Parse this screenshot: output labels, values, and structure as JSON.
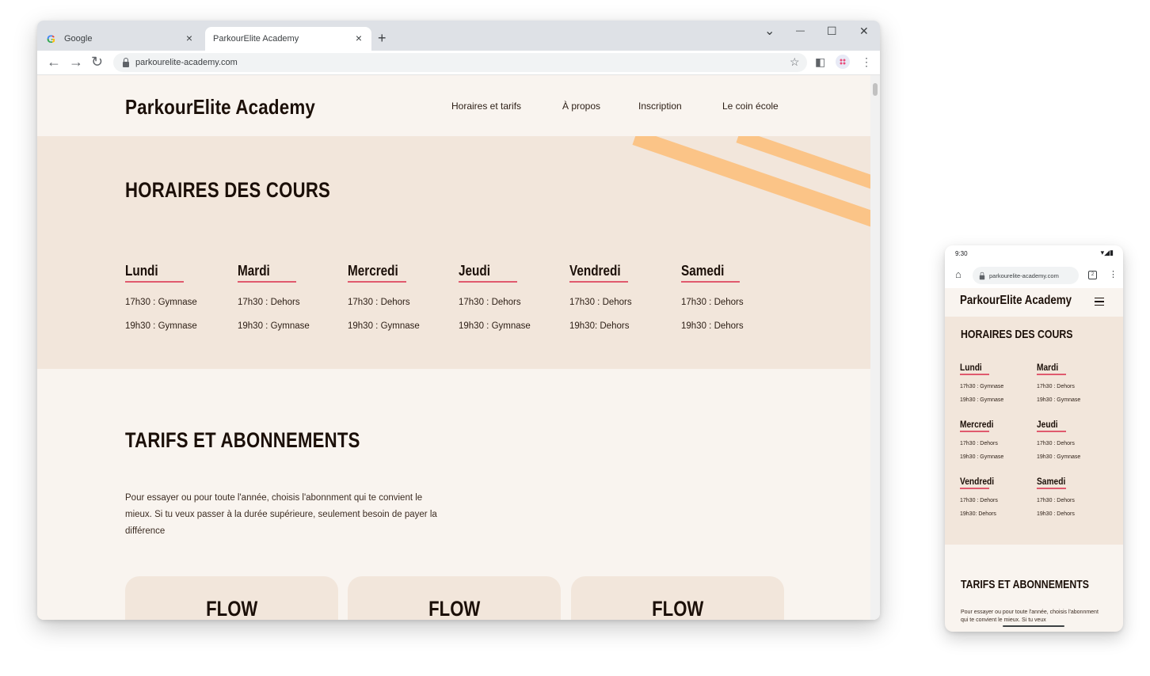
{
  "browser": {
    "tabs": [
      {
        "label": "Google",
        "icon": "google-icon"
      },
      {
        "label": "ParkourElite Academy",
        "active": true
      }
    ],
    "url": "parkourelite-academy.com",
    "new_tab_symbol": "+",
    "close_symbol": "×",
    "window_controls": {
      "chevron": "⌄",
      "minimize": "—",
      "maximize": "☐",
      "close": "✕"
    },
    "nav": {
      "back": "←",
      "forward": "→",
      "reload": "↻"
    },
    "toolbar_icons": {
      "bookmark": "☆",
      "sidepanel": "◧",
      "menu": "⋮"
    }
  },
  "site": {
    "logo": "ParkourElite Academy",
    "nav": [
      "Horaires et tarifs",
      "À propos",
      "Inscription",
      "Le coin école"
    ],
    "schedule": {
      "title": "HORAIRES DES COURS",
      "days": [
        {
          "name": "Lundi",
          "slots": [
            "17h30 : Gymnase",
            "19h30 : Gymnase"
          ]
        },
        {
          "name": "Mardi",
          "slots": [
            "17h30 : Dehors",
            "19h30 : Gymnase"
          ]
        },
        {
          "name": "Mercredi",
          "slots": [
            "17h30 : Dehors",
            "19h30 : Gymnase"
          ]
        },
        {
          "name": "Jeudi",
          "slots": [
            "17h30 : Dehors",
            "19h30 : Gymnase"
          ]
        },
        {
          "name": "Vendredi",
          "slots": [
            "17h30 : Dehors",
            "19h30: Dehors"
          ]
        },
        {
          "name": "Samedi",
          "slots": [
            "17h30 : Dehors",
            "19h30 : Dehors"
          ]
        }
      ]
    },
    "tarifs": {
      "title": "TARIFS ET ABONNEMENTS",
      "text": "Pour essayer ou pour toute l'année, choisis l'abonnment qui te convient le mieux. Si tu veux passer à la durée supérieure, seulement besoin de payer la différence",
      "cards": [
        "FLOW",
        "FLOW",
        "FLOW"
      ]
    }
  },
  "mobile": {
    "time": "9:30",
    "status_icons": "▾◢▮",
    "url": "parkourelite-academy.com",
    "tab_count": "2",
    "home_symbol": "⌂",
    "menu_symbol": "⋮",
    "text_preview": "Pour essayer ou pour toute l'année, choisis l'abonnment qui te convient le mieux. Si tu veux"
  },
  "colors": {
    "page_bg": "#f9f4ef",
    "section_bg": "#f2e6db",
    "stripe": "#fbc487",
    "underline": "#e05a6e",
    "heading": "#1b0f08"
  }
}
